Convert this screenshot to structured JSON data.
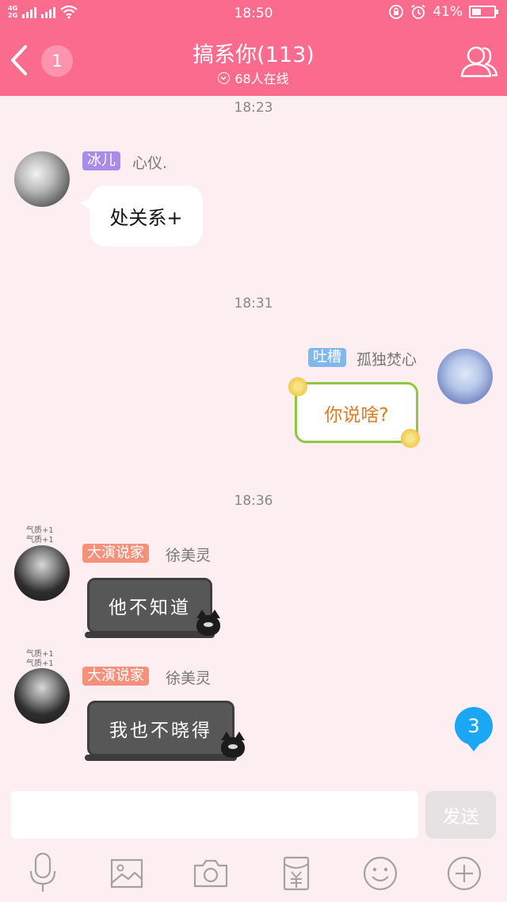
{
  "status_bar": {
    "network_top": "4G",
    "network_bottom": "2G",
    "time": "18:50",
    "battery": "41%"
  },
  "header": {
    "unread_count": "1",
    "title": "搞系你(113)",
    "online": "68人在线"
  },
  "messages": [
    {
      "timestamp": "18:23",
      "tag": "冰儿",
      "name": "心仪.",
      "text": "处关系+"
    },
    {
      "timestamp": "18:31",
      "tag": "吐槽",
      "name": "孤独焚心",
      "text": "你说啥?"
    },
    {
      "timestamp": "18:36",
      "tag": "大演说家",
      "name": "徐美灵",
      "text": "他不知道",
      "badge": "气质+1"
    },
    {
      "tag": "大演说家",
      "name": "徐美灵",
      "text": "我也不晓得",
      "badge": "气质+1"
    }
  ],
  "floating_badge": "3",
  "composer": {
    "placeholder": "",
    "send_label": "发送"
  },
  "colors": {
    "header": "#fb6b8e",
    "background": "#fdeef1",
    "tag_purple": "#a98bea",
    "tag_blue": "#7fb8ef",
    "tag_orange": "#f5907b",
    "badge_blue": "#1aa7f5"
  },
  "toolbar_icons": [
    "microphone-icon",
    "image-icon",
    "camera-icon",
    "red-packet-icon",
    "emoji-icon",
    "plus-icon"
  ]
}
